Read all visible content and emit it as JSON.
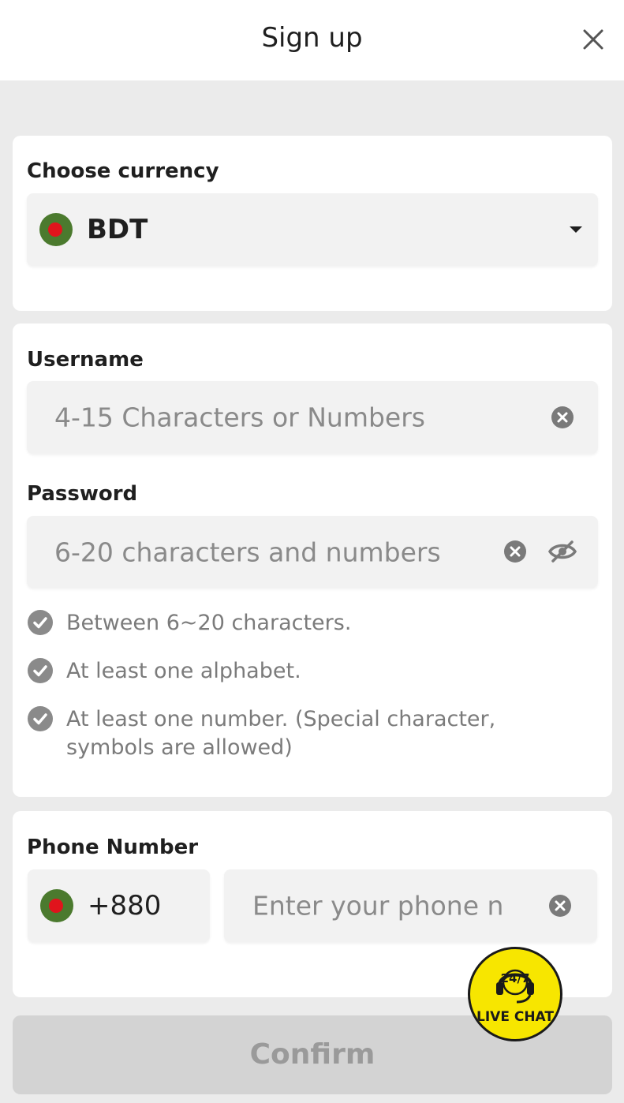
{
  "header": {
    "title": "Sign up"
  },
  "currency": {
    "label": "Choose currency",
    "selected": "BDT"
  },
  "username": {
    "label": "Username",
    "placeholder": "4-15 Characters or Numbers"
  },
  "password": {
    "label": "Password",
    "placeholder": "6-20 characters and numbers",
    "rules": [
      "Between 6~20 characters.",
      "At least one alphabet.",
      "At least one number. (Special character, symbols are allowed)"
    ]
  },
  "phone": {
    "label": "Phone Number",
    "country_code": "+880",
    "placeholder": "Enter your phone n"
  },
  "confirm": {
    "label": "Confirm"
  },
  "live_chat": {
    "badge": "24/7",
    "label": "LIVE CHAT"
  },
  "colors": {
    "background": "#ebebeb",
    "card": "#ffffff",
    "field": "#f2f2f2",
    "flag_green": "#4b7a2e",
    "flag_red": "#e0141c",
    "live_chat_yellow": "#f7e600",
    "button_disabled": "#d3d3d3"
  },
  "icons": {
    "close": "close-icon",
    "dropdown": "caret-down-icon",
    "clear": "clear-circle-icon",
    "visibility": "eye-slash-icon",
    "rule": "check-circle-icon",
    "support": "headset-icon"
  }
}
